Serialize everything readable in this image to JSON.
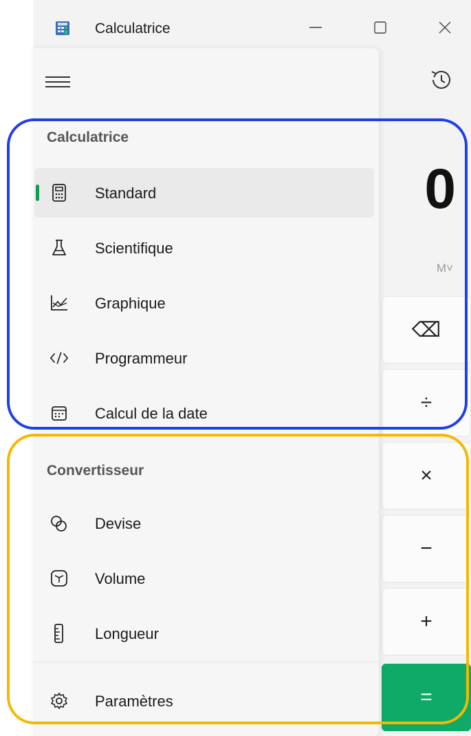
{
  "window": {
    "title": "Calculatrice",
    "caption_minimize": "—",
    "caption_maximize": "☐",
    "caption_close": "✕"
  },
  "calculator": {
    "display_value": "0",
    "memory_label": "M˅",
    "keys": [
      "⌫",
      "÷",
      "×",
      "−",
      "+",
      "="
    ]
  },
  "nav": {
    "sections": [
      {
        "header": "Calculatrice",
        "items": [
          {
            "label": "Standard",
            "icon": "calculator-icon",
            "selected": true
          },
          {
            "label": "Scientifique",
            "icon": "flask-icon"
          },
          {
            "label": "Graphique",
            "icon": "graph-icon"
          },
          {
            "label": "Programmeur",
            "icon": "code-icon"
          },
          {
            "label": "Calcul de la date",
            "icon": "calendar-icon"
          }
        ]
      },
      {
        "header": "Convertisseur",
        "items": [
          {
            "label": "Devise",
            "icon": "currency-icon"
          },
          {
            "label": "Volume",
            "icon": "cube-icon"
          },
          {
            "label": "Longueur",
            "icon": "ruler-icon"
          }
        ]
      }
    ],
    "settings_label": "Paramètres"
  },
  "colors": {
    "accent": "#0f9d58",
    "highlight_calculator": "#1f3fe8",
    "highlight_converter": "#f5b800"
  }
}
